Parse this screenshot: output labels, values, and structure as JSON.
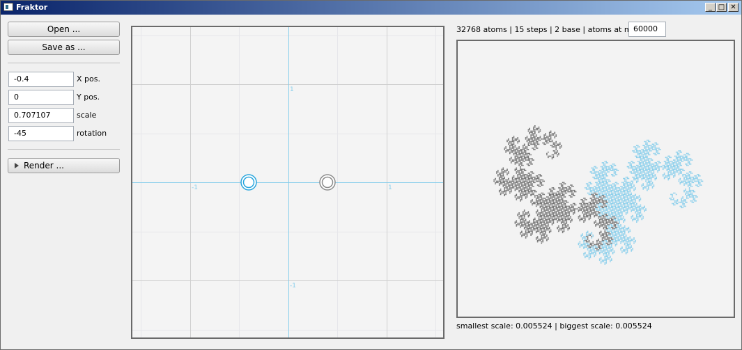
{
  "window": {
    "title": "Fraktor"
  },
  "title_buttons": {
    "minimize": "_",
    "maximize": "□",
    "close": "✕"
  },
  "sidebar": {
    "open_label": "Open ...",
    "save_label": "Save as ...",
    "x_pos": {
      "value": "-0.4",
      "label": "X pos."
    },
    "y_pos": {
      "value": "0",
      "label": "Y pos."
    },
    "scale": {
      "value": "0.707107",
      "label": "scale"
    },
    "rotation": {
      "value": "-45",
      "label": "rotation"
    },
    "render_label": "Render ..."
  },
  "editor": {
    "tick_labels": {
      "x_neg": "-1",
      "x_pos": "1",
      "y_pos": "1",
      "y_neg": "-1"
    },
    "colors": {
      "grid": "#cfcfcf",
      "axis": "#87ceeb",
      "selected_circle": "#2aa6dd",
      "other_circle": "#8c8c8c"
    }
  },
  "info": {
    "atoms": "32768 atoms",
    "steps": "15 steps",
    "base": "2 base",
    "atoms_at_most_label": "atoms at most:",
    "atoms_at_most_value": "60000"
  },
  "preview": {
    "colors": {
      "dark": "#6e6e6e",
      "light": "#87ceeb"
    }
  },
  "footer": {
    "smallest_scale_label": "smallest scale:",
    "smallest_scale_value": "0.005524",
    "biggest_scale_label": "biggest scale:",
    "biggest_scale_value": "0.005524"
  }
}
